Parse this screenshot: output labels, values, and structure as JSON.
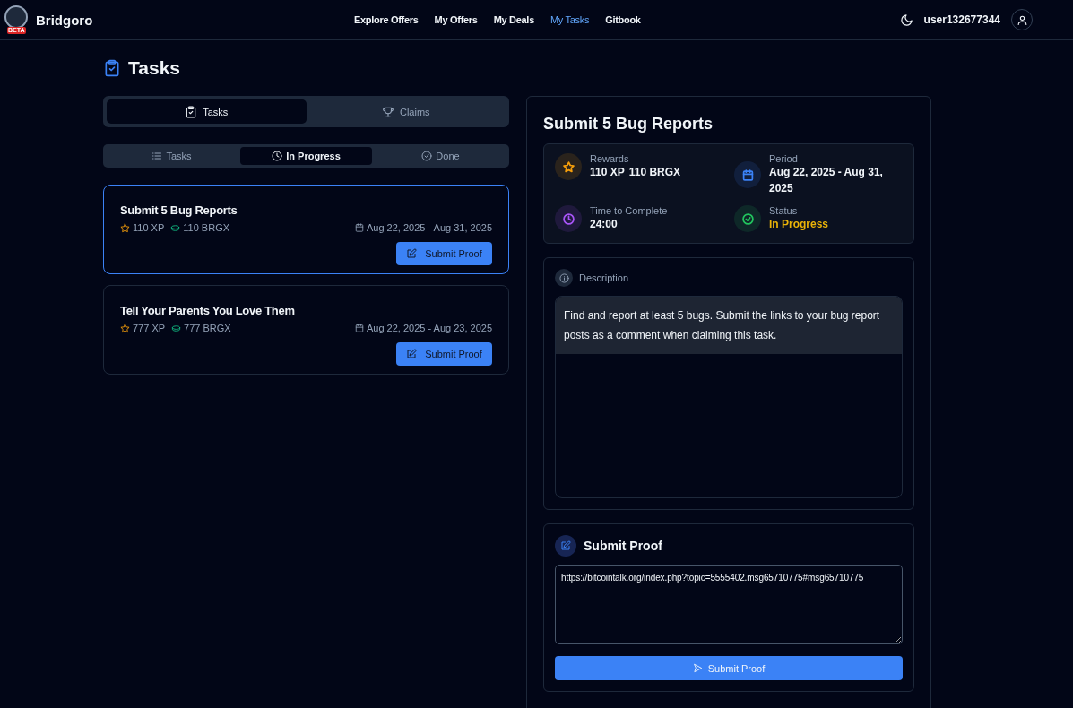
{
  "header": {
    "brand": "Bridgoro",
    "badge": "BETA",
    "nav": [
      {
        "label": "Explore Offers",
        "selected": false
      },
      {
        "label": "My Offers",
        "selected": false
      },
      {
        "label": "My Deals",
        "selected": false
      },
      {
        "label": "My Tasks",
        "selected": true
      },
      {
        "label": "Gitbook",
        "selected": false
      }
    ],
    "username": "user132677344"
  },
  "page_title": "Tasks",
  "main_tabs": [
    {
      "label": "Tasks",
      "kind": "clipboard",
      "selected": true
    },
    {
      "label": "Claims",
      "kind": "trophy",
      "selected": false
    }
  ],
  "filter_tabs": [
    {
      "label": "Tasks",
      "kind": "list",
      "selected": false
    },
    {
      "label": "In Progress",
      "kind": "clock",
      "selected": true
    },
    {
      "label": "Done",
      "kind": "check",
      "selected": false
    }
  ],
  "tasks": [
    {
      "title": "Submit 5 Bug Reports",
      "xp": "110 XP",
      "tokens": "110 BRGX",
      "period": "Aug 22, 2025 - Aug 31, 2025",
      "button": "Submit Proof",
      "selected": true
    },
    {
      "title": "Tell Your Parents You Love Them",
      "xp": "777 XP",
      "tokens": "777 BRGX",
      "period": "Aug 22, 2025 - Aug 23, 2025",
      "button": "Submit Proof",
      "selected": false
    }
  ],
  "detail": {
    "title": "Submit 5 Bug Reports",
    "info": [
      {
        "kind": "rewards",
        "label": "Rewards",
        "values": [
          "110 XP",
          "110 BRGX"
        ],
        "color": "#f59e0b"
      },
      {
        "kind": "period",
        "label": "Period",
        "values": [
          "Aug 22, 2025 - Aug 31, 2025"
        ],
        "color": "#3b82f6"
      },
      {
        "kind": "time",
        "label": "Time to Complete",
        "values": [
          "24:00"
        ],
        "color": "#a855f7"
      },
      {
        "kind": "status",
        "label": "Status",
        "values": [
          "In Progress"
        ],
        "color": "#22c55e"
      }
    ],
    "description": {
      "heading": "Description",
      "text": "Find and report at least 5 bugs. Submit the links to your bug report posts as a comment when claiming this task."
    },
    "proof": {
      "heading": "Submit Proof",
      "value": "https://bitcointalk.org/index.php?topic=5555402.msg65710775#msg65710775",
      "button": "Submit Proof"
    }
  }
}
